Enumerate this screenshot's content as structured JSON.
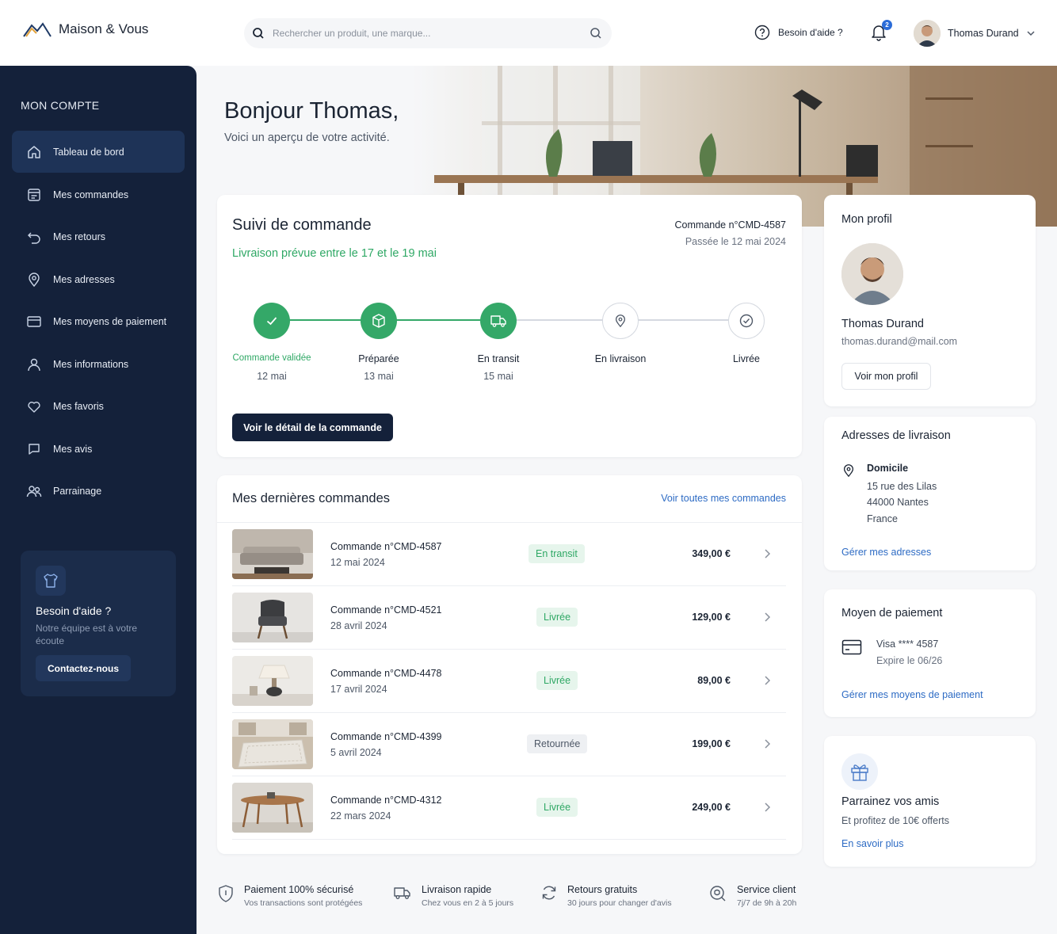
{
  "header": {
    "logo_text": "Maison & Vous",
    "search_placeholder": "Rechercher un produit, une marque...",
    "help_label": "Besoin d'aide ?",
    "notification_count": "2",
    "user_name": "Thomas Durand"
  },
  "sidebar": {
    "title": "MON COMPTE",
    "items": [
      {
        "label": "Tableau de bord",
        "icon": "home-icon",
        "active": true
      },
      {
        "label": "Mes commandes",
        "icon": "orders-icon"
      },
      {
        "label": "Mes retours",
        "icon": "return-icon"
      },
      {
        "label": "Mes adresses",
        "icon": "location-pin-icon"
      },
      {
        "label": "Mes moyens de paiement",
        "icon": "credit-card-icon"
      },
      {
        "label": "Mes informations",
        "icon": "user-icon"
      },
      {
        "label": "Mes favoris",
        "icon": "heart-icon"
      },
      {
        "label": "Mes avis",
        "icon": "chat-bubble-icon"
      },
      {
        "label": "Parrainage",
        "icon": "users-icon"
      }
    ],
    "help_card": {
      "title": "Besoin d'aide ?",
      "text": "Notre équipe est à votre écoute",
      "button": "Contactez-nous"
    }
  },
  "hero": {
    "greeting": "Bonjour Thomas,",
    "subtitle": "Voici un aperçu de votre activité."
  },
  "tracking": {
    "title": "Suivi de commande",
    "delivery": "Livraison prévue entre le 17 et le 19 mai",
    "order_number": "Commande n°CMD-4587",
    "order_date": "Passée le 12 mai 2024",
    "steps": [
      {
        "label": "Commande validée",
        "date": "12 mai",
        "status": "done",
        "icon": "check-icon"
      },
      {
        "label": "Préparée",
        "date": "13 mai",
        "status": "done",
        "icon": "box-icon"
      },
      {
        "label": "En transit",
        "date": "15 mai",
        "status": "done",
        "icon": "truck-icon"
      },
      {
        "label": "En livraison",
        "date": "",
        "status": "todo",
        "icon": "location-pin-icon"
      },
      {
        "label": "Livrée",
        "date": "",
        "status": "todo",
        "icon": "check-circle-icon"
      }
    ],
    "button": "Voir le détail de la commande"
  },
  "orders": {
    "title": "Mes dernières commandes",
    "view_all": "Voir toutes mes commandes",
    "rows": [
      {
        "name": "Commande n°CMD-4587",
        "date": "12 mai 2024",
        "status": "En transit",
        "status_type": "green",
        "price": "349,00 €",
        "thumb": "sofa"
      },
      {
        "name": "Commande n°CMD-4521",
        "date": "28 avril 2024",
        "status": "Livrée",
        "status_type": "green",
        "price": "129,00 €",
        "thumb": "armchair"
      },
      {
        "name": "Commande n°CMD-4478",
        "date": "17 avril 2024",
        "status": "Livrée",
        "status_type": "green",
        "price": "89,00 €",
        "thumb": "lamp"
      },
      {
        "name": "Commande n°CMD-4399",
        "date": "5 avril 2024",
        "status": "Retournée",
        "status_type": "gray",
        "price": "199,00 €",
        "thumb": "rug"
      },
      {
        "name": "Commande n°CMD-4312",
        "date": "22 mars 2024",
        "status": "Livrée",
        "status_type": "green",
        "price": "249,00 €",
        "thumb": "table"
      }
    ]
  },
  "profile": {
    "title": "Mon profil",
    "name": "Thomas Durand",
    "email": "thomas.durand@mail.com",
    "button": "Voir mon profil"
  },
  "addresses": {
    "title": "Adresses de livraison",
    "label": "Domicile",
    "line1": "15 rue des Lilas",
    "line2": "44000 Nantes",
    "line3": "France",
    "link": "Gérer mes adresses"
  },
  "payment": {
    "title": "Moyen de paiement",
    "card": "Visa **** 4587",
    "expiry": "Expire le 06/26",
    "link": "Gérer mes moyens de paiement"
  },
  "referral": {
    "title": "Parrainez vos amis",
    "text": "Et profitez de 10€ offerts",
    "link": "En savoir plus"
  },
  "features": [
    {
      "title": "Paiement 100% sécurisé",
      "text": "Vos transactions sont protégées",
      "icon": "shield-icon"
    },
    {
      "title": "Livraison rapide",
      "text": "Chez vous en 2 à 5 jours",
      "icon": "truck-icon"
    },
    {
      "title": "Retours gratuits",
      "text": "30 jours pour changer d'avis",
      "icon": "refresh-icon"
    },
    {
      "title": "Service client",
      "text": "7j/7 de 9h à 20h",
      "icon": "support-icon"
    }
  ],
  "colors": {
    "sidebar": "#14213a",
    "accent_green": "#34a868",
    "link_blue": "#2d6bc4"
  }
}
